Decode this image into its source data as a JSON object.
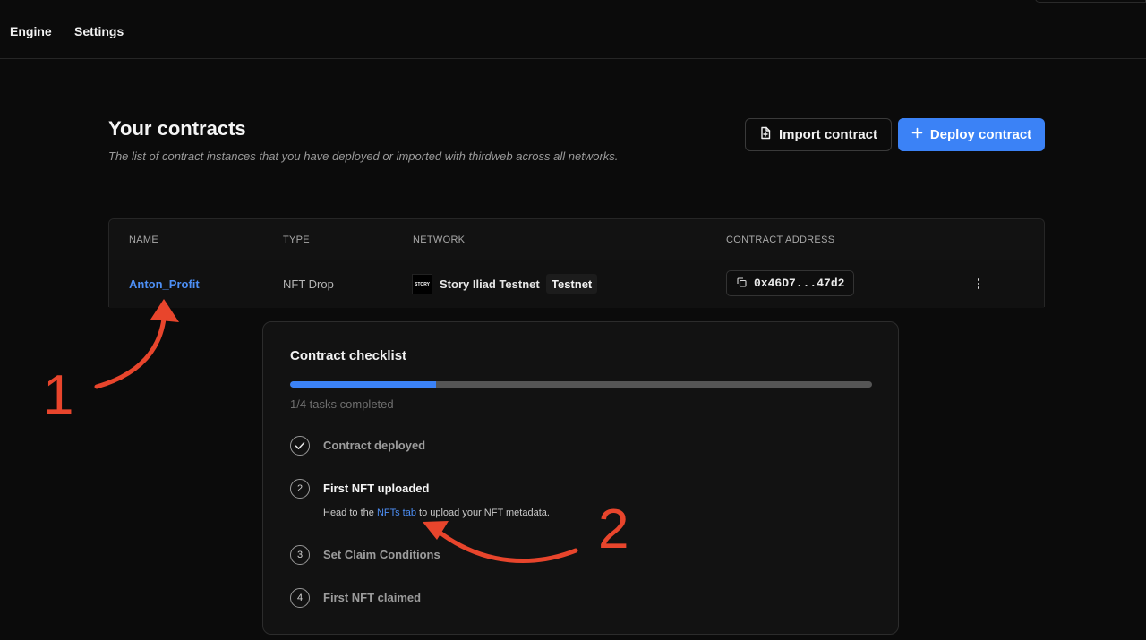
{
  "nav": {
    "items": [
      "Engine",
      "Settings"
    ]
  },
  "header": {
    "title": "Your contracts",
    "subtitle": "The list of contract instances that you have deployed or imported with thirdweb across all networks.",
    "import_label": "Import contract",
    "deploy_label": "Deploy contract"
  },
  "table": {
    "columns": [
      "NAME",
      "TYPE",
      "NETWORK",
      "CONTRACT ADDRESS"
    ],
    "rows": [
      {
        "name": "Anton_Profit",
        "type": "NFT Drop",
        "network_logo": "STORY",
        "network": "Story Iliad Testnet",
        "badge": "Testnet",
        "address": "0x46D7...47d2"
      }
    ]
  },
  "checklist": {
    "title": "Contract checklist",
    "progress_fraction": 0.25,
    "progress_text": "1/4 tasks completed",
    "steps": [
      {
        "number": "",
        "label": "Contract deployed",
        "done": true
      },
      {
        "number": "2",
        "label": "First NFT uploaded",
        "desc_prefix": "Head to the ",
        "desc_link": "NFTs tab",
        "desc_suffix": " to upload your NFT metadata."
      },
      {
        "number": "3",
        "label": "Set Claim Conditions"
      },
      {
        "number": "4",
        "label": "First NFT claimed"
      }
    ]
  },
  "annotations": {
    "one": "1",
    "two": "2",
    "color": "#e8452c"
  },
  "colors": {
    "accent": "#3b82f6",
    "link": "#4d8ff5",
    "background": "#0b0b0b"
  }
}
